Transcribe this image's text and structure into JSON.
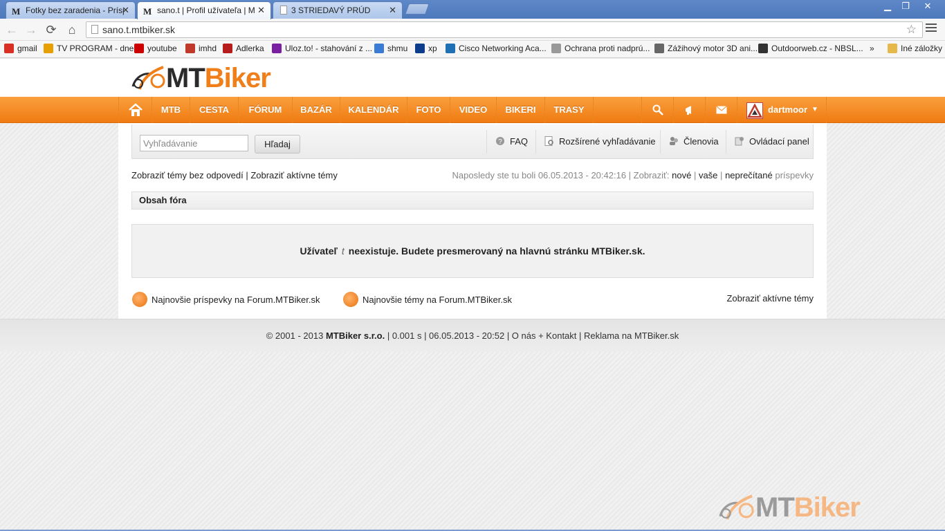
{
  "browser": {
    "tabs": [
      {
        "title": "Fotky bez zaradenia - Príspevky",
        "fav": "M"
      },
      {
        "title": "sano.t | Profil užívateľa | MTBiker",
        "fav": "M"
      },
      {
        "title": "3 STRIEDAVÝ PRÚD",
        "fav": ""
      }
    ],
    "url": "sano.t.mtbiker.sk",
    "bookmarks": [
      {
        "label": "gmail",
        "color": "#d93025"
      },
      {
        "label": "TV PROGRAM - dnes",
        "color": "#e8a000"
      },
      {
        "label": "youtube",
        "color": "#cc0000"
      },
      {
        "label": "imhd",
        "color": "#c0392b"
      },
      {
        "label": "Adlerka",
        "color": "#b71c1c"
      },
      {
        "label": "Uloz.to! - stahování z ...",
        "color": "#7b1fa2"
      },
      {
        "label": "shmu",
        "color": "#3a7bd5"
      },
      {
        "label": "xp",
        "color": "#0d3c8c"
      },
      {
        "label": "Cisco Networking Aca...",
        "color": "#1e6fb3"
      },
      {
        "label": "Ochrana proti nadprú...",
        "color": "#999999"
      },
      {
        "label": "Zážihový motor 3D ani...",
        "color": "#666666"
      },
      {
        "label": "Outdoorweb.cz - NBSL...",
        "color": "#333333"
      },
      {
        "label": "»",
        "color": ""
      },
      {
        "label": "Iné záložky",
        "color": "#e6b84a"
      }
    ]
  },
  "site": {
    "logo_mt": "MT",
    "logo_biker": "Biker",
    "nav": [
      "MTB",
      "CESTA",
      "FÓRUM",
      "BAZÁR",
      "KALENDÁR",
      "FOTO",
      "VIDEO",
      "BIKERI",
      "TRASY"
    ],
    "username": "dartmoor",
    "accent": "#f07b12"
  },
  "search": {
    "placeholder": "Vyhľadávanie",
    "button": "Hľadaj",
    "faq": "FAQ",
    "advanced": "Rozšírené vyhľadávanie",
    "members": "Členovia",
    "control_panel": "Ovládací panel"
  },
  "links": {
    "unanswered": "Zobraziť témy bez odpovedí",
    "sep": "|",
    "active": "Zobraziť aktívne témy",
    "last_visit": "Naposledy ste tu boli 06.05.2013 - 20:42:16 | Zobraziť:",
    "new": "nové",
    "yours": "vaše",
    "unread": "neprečítané",
    "posts": "príspevky"
  },
  "forum": {
    "title": "Obsah fóra",
    "msg_pre": "Užívateľ",
    "msg_user": "t",
    "msg_post": "neexistuje. Budete presmerovaný na hlavnú stránku MTBiker.sk."
  },
  "rss": {
    "latest_posts": "Najnovšie príspevky na Forum.MTBiker.sk",
    "latest_topics": "Najnovšie témy na Forum.MTBiker.sk",
    "active_topics": "Zobraziť aktívne témy"
  },
  "footer": {
    "copy": "© 2001 - 2013",
    "company": "MTBiker s.r.o.",
    "rest": "| 0.001 s | 06.05.2013 - 20:52 | O nás + Kontakt | Reklama na MTBiker.sk"
  }
}
